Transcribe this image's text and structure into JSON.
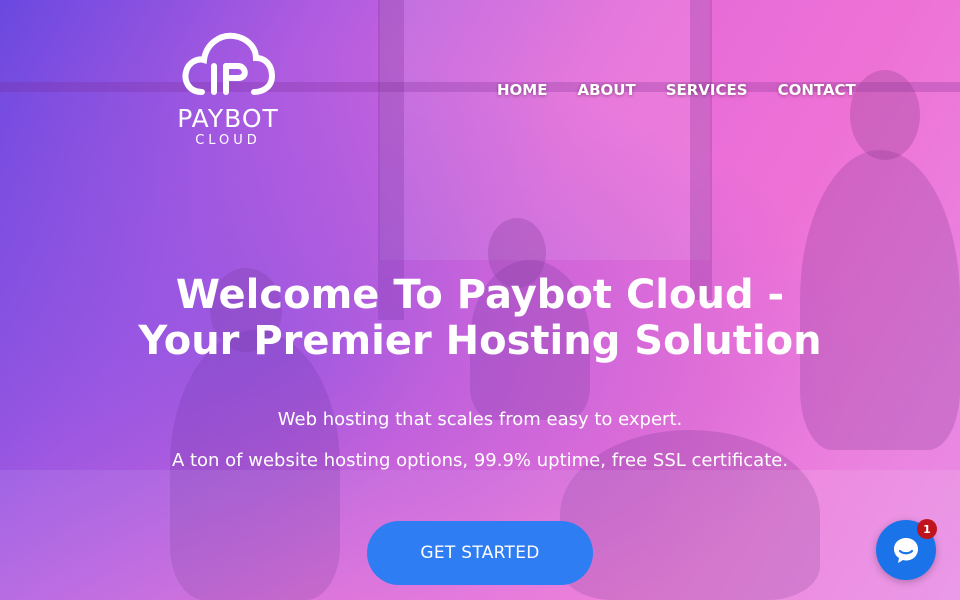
{
  "brand": {
    "name": "PAYBOT",
    "tagline": "CLOUD"
  },
  "nav": {
    "items": [
      {
        "label": "HOME"
      },
      {
        "label": "ABOUT"
      },
      {
        "label": "SERVICES"
      },
      {
        "label": "CONTACT"
      }
    ]
  },
  "hero": {
    "headline_line1": "Welcome To Paybot Cloud -",
    "headline_line2": "Your Premier Hosting Solution",
    "subtitle1": "Web hosting that scales from easy to expert.",
    "subtitle2": "A ton of website hosting options, 99.9% uptime, free SSL certificate.",
    "cta_label": "GET STARTED"
  },
  "chat_widget": {
    "badge_count": "1",
    "icon": "chat-bubble-icon"
  },
  "colors": {
    "gradient_left": "#6a48e0",
    "gradient_right": "#ee72d6",
    "cta": "#2f7df2",
    "chat": "#1a73e8",
    "badge": "#c0141c"
  }
}
